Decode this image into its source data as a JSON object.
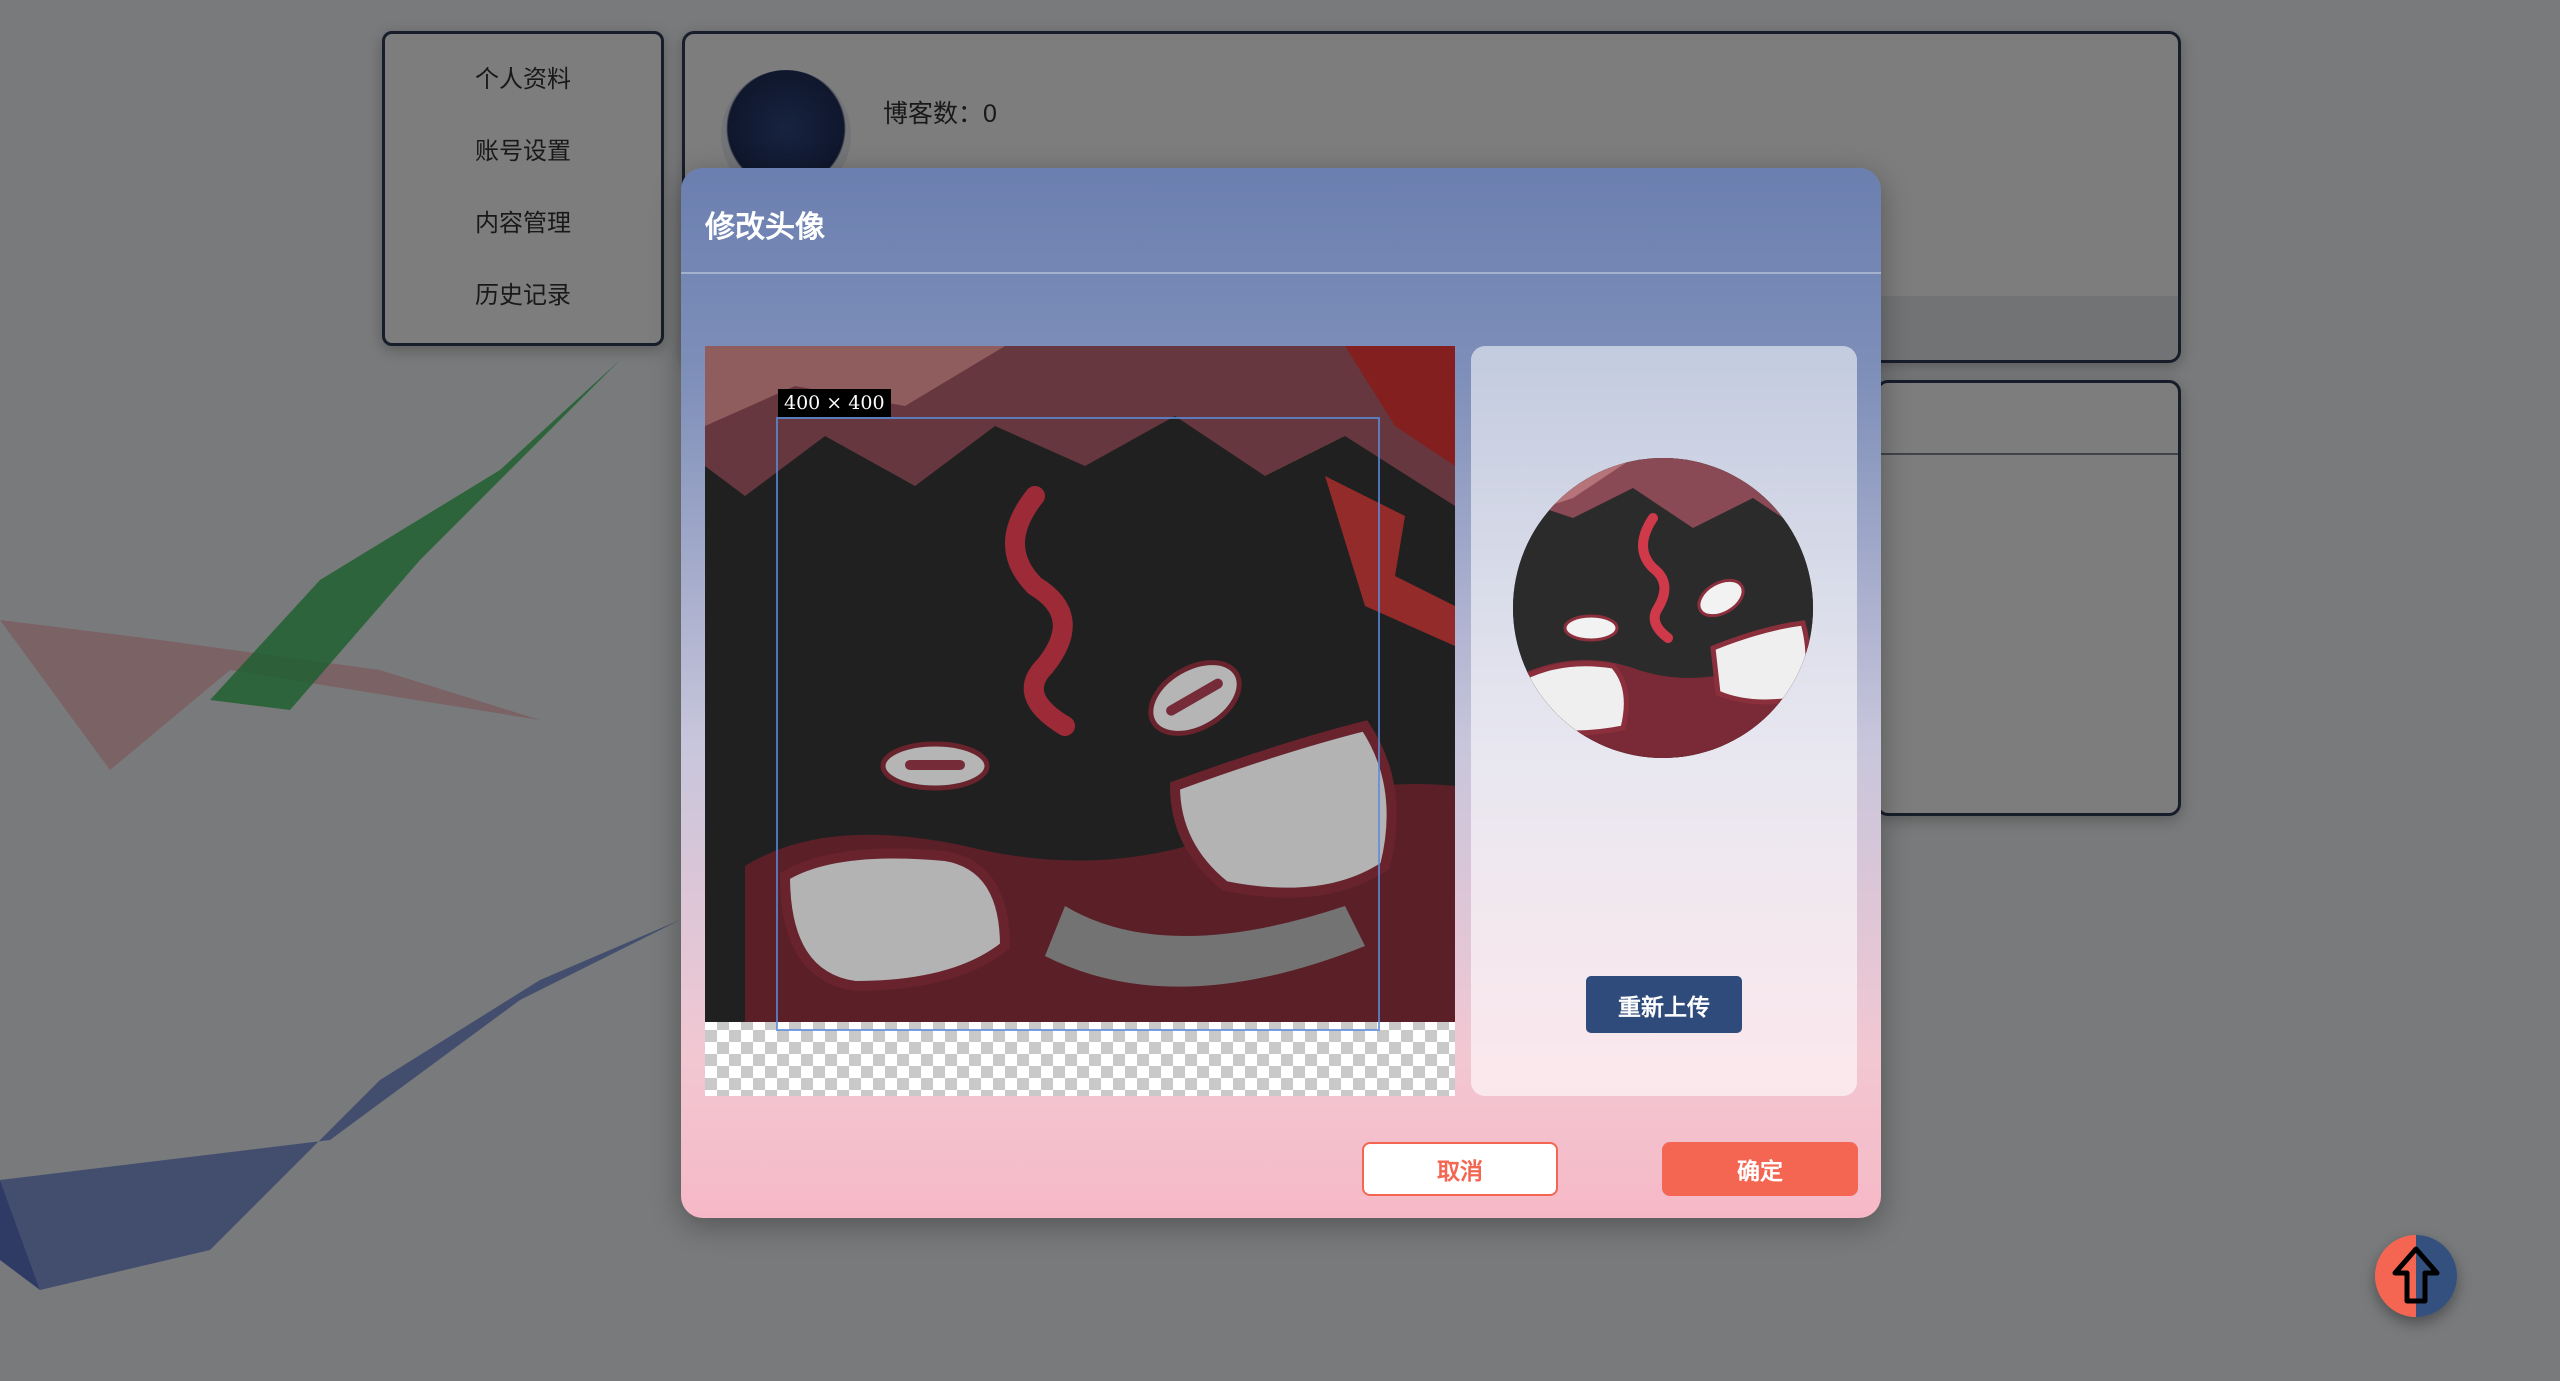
{
  "side_menu": {
    "items": [
      {
        "label": "个人资料"
      },
      {
        "label": "账号设置"
      },
      {
        "label": "内容管理"
      },
      {
        "label": "历史记录"
      }
    ]
  },
  "profile": {
    "blog_count_label": "博客数：0"
  },
  "dialog": {
    "title": "修改头像",
    "crop_size_label": "400 × 400",
    "reupload_label": "重新上传",
    "cancel_label": "取消",
    "confirm_label": "确定"
  },
  "fab": {
    "icon": "arrow-up-icon"
  },
  "colors": {
    "accent": "#f46652",
    "primary": "#2f4b7c",
    "border": "#2f3b55"
  }
}
